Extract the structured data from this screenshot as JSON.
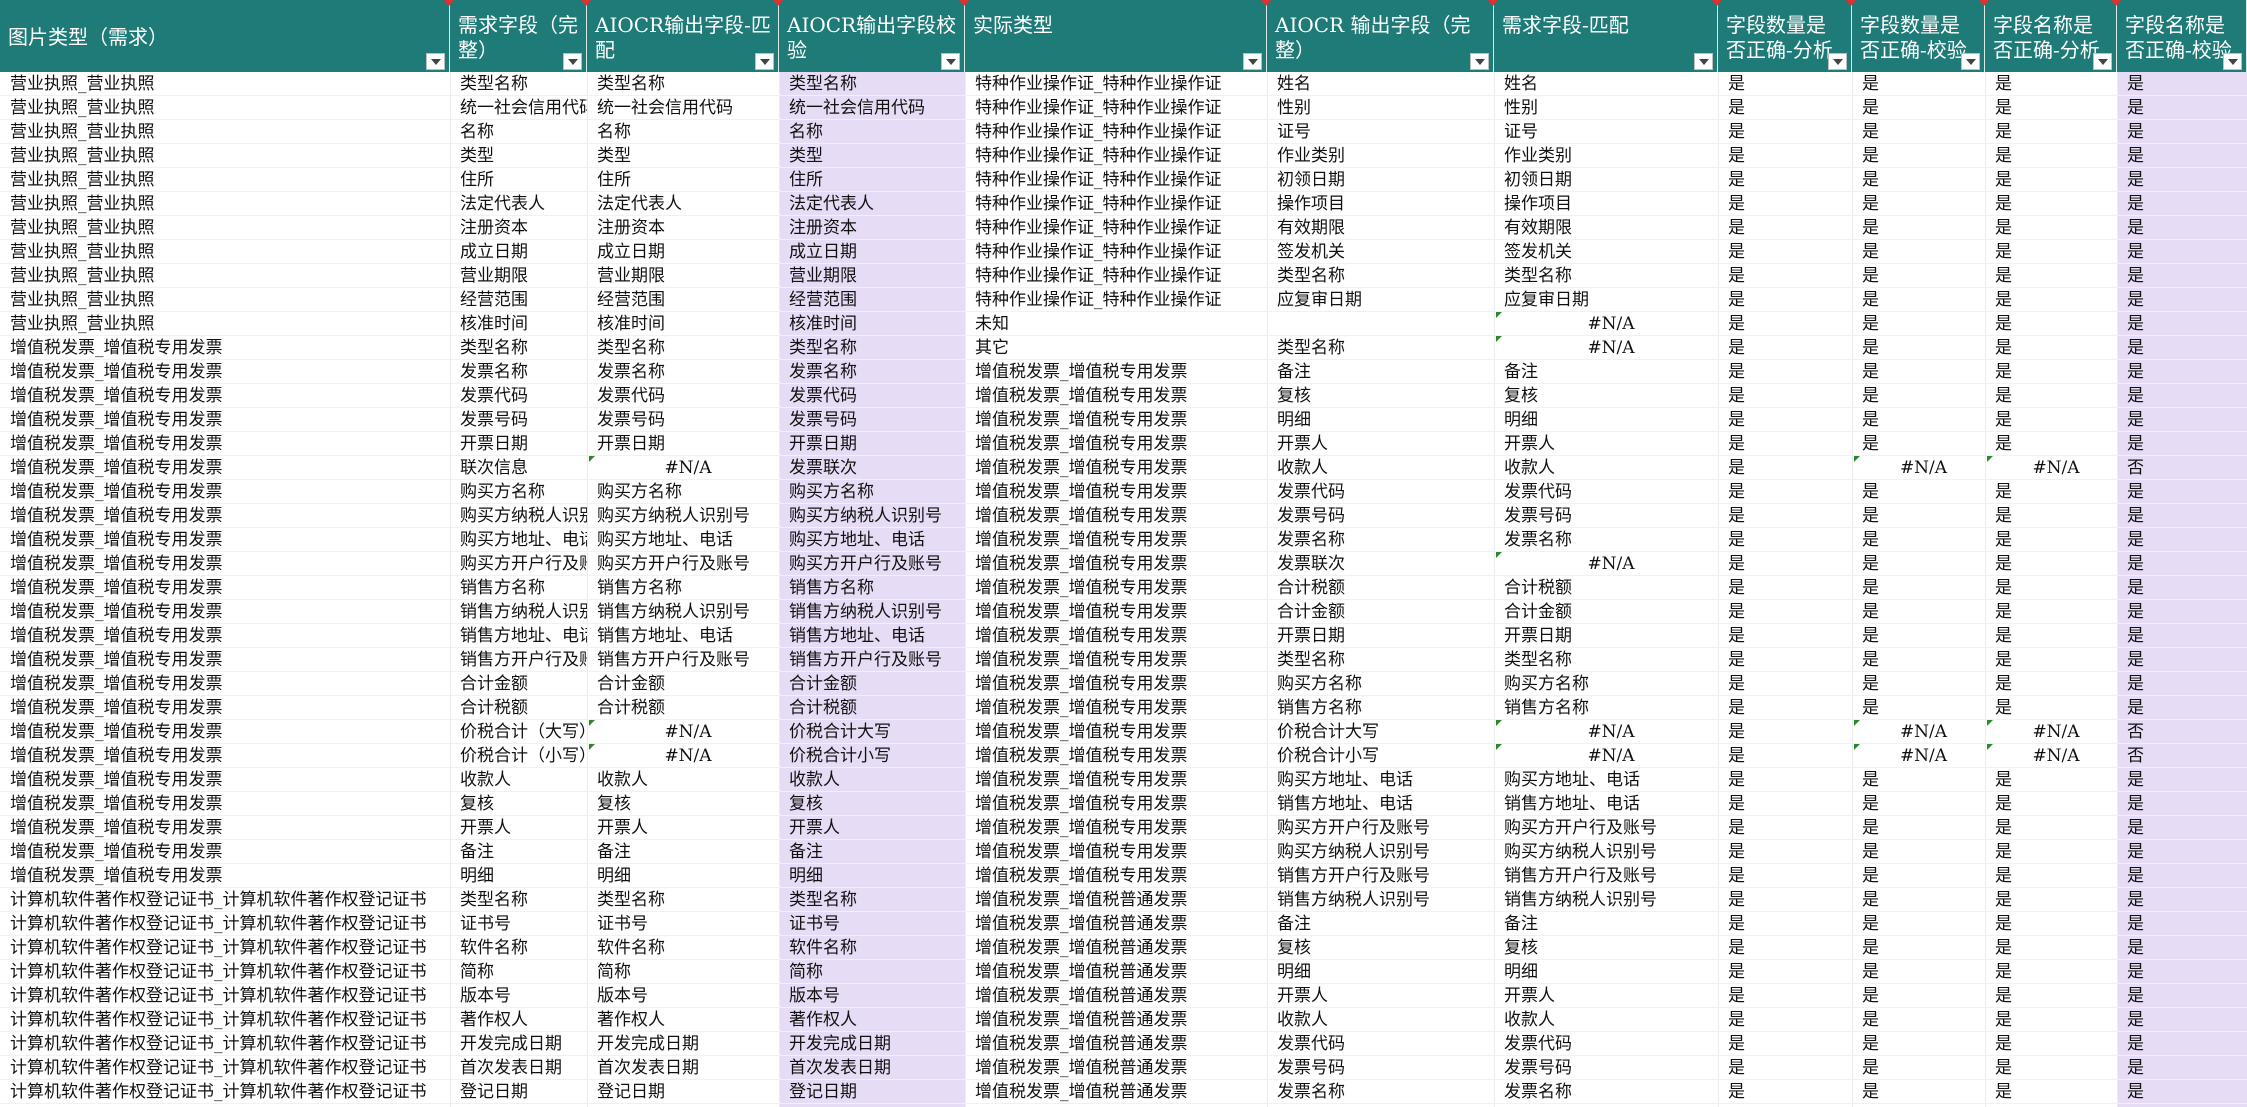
{
  "headers": [
    "图片类型（需求）",
    "需求字段（完整）",
    "AIOCR输出字段-匹配",
    "AIOCR输出字段校验",
    "实际类型",
    "AIOCR 输出字段（完整）",
    "需求字段-匹配",
    "字段数量是否正确-分析",
    "字段数量是否正确-校验",
    "字段名称是否正确-分析",
    "字段名称是否正确-校验"
  ],
  "colors": {
    "header_bg": "#1f7b77",
    "validation_col_bg": "#e6dcf5",
    "error_triangle": "#2a8a2a"
  },
  "icons": [
    "filter-dropdown-icon",
    "comment-marker-icon",
    "error-indicator-icon"
  ],
  "rows": [
    [
      "营业执照_营业执照",
      "类型名称",
      "类型名称",
      "类型名称",
      "特种作业操作证_特种作业操作证",
      "姓名",
      "姓名",
      "是",
      "是",
      "是",
      "是"
    ],
    [
      "营业执照_营业执照",
      "统一社会信用代码",
      "统一社会信用代码",
      "统一社会信用代码",
      "特种作业操作证_特种作业操作证",
      "性别",
      "性别",
      "是",
      "是",
      "是",
      "是"
    ],
    [
      "营业执照_营业执照",
      "名称",
      "名称",
      "名称",
      "特种作业操作证_特种作业操作证",
      "证号",
      "证号",
      "是",
      "是",
      "是",
      "是"
    ],
    [
      "营业执照_营业执照",
      "类型",
      "类型",
      "类型",
      "特种作业操作证_特种作业操作证",
      "作业类别",
      "作业类别",
      "是",
      "是",
      "是",
      "是"
    ],
    [
      "营业执照_营业执照",
      "住所",
      "住所",
      "住所",
      "特种作业操作证_特种作业操作证",
      "初领日期",
      "初领日期",
      "是",
      "是",
      "是",
      "是"
    ],
    [
      "营业执照_营业执照",
      "法定代表人",
      "法定代表人",
      "法定代表人",
      "特种作业操作证_特种作业操作证",
      "操作项目",
      "操作项目",
      "是",
      "是",
      "是",
      "是"
    ],
    [
      "营业执照_营业执照",
      "注册资本",
      "注册资本",
      "注册资本",
      "特种作业操作证_特种作业操作证",
      "有效期限",
      "有效期限",
      "是",
      "是",
      "是",
      "是"
    ],
    [
      "营业执照_营业执照",
      "成立日期",
      "成立日期",
      "成立日期",
      "特种作业操作证_特种作业操作证",
      "签发机关",
      "签发机关",
      "是",
      "是",
      "是",
      "是"
    ],
    [
      "营业执照_营业执照",
      "营业期限",
      "营业期限",
      "营业期限",
      "特种作业操作证_特种作业操作证",
      "类型名称",
      "类型名称",
      "是",
      "是",
      "是",
      "是"
    ],
    [
      "营业执照_营业执照",
      "经营范围",
      "经营范围",
      "经营范围",
      "特种作业操作证_特种作业操作证",
      "应复审日期",
      "应复审日期",
      "是",
      "是",
      "是",
      "是"
    ],
    [
      "营业执照_营业执照",
      "核准时间",
      "核准时间",
      "核准时间",
      "未知",
      "",
      "#N/A",
      "是",
      "是",
      "是",
      "是"
    ],
    [
      "增值税发票_增值税专用发票",
      "类型名称",
      "类型名称",
      "类型名称",
      "其它",
      "类型名称",
      "#N/A",
      "是",
      "是",
      "是",
      "是"
    ],
    [
      "增值税发票_增值税专用发票",
      "发票名称",
      "发票名称",
      "发票名称",
      "增值税发票_增值税专用发票",
      "备注",
      "备注",
      "是",
      "是",
      "是",
      "是"
    ],
    [
      "增值税发票_增值税专用发票",
      "发票代码",
      "发票代码",
      "发票代码",
      "增值税发票_增值税专用发票",
      "复核",
      "复核",
      "是",
      "是",
      "是",
      "是"
    ],
    [
      "增值税发票_增值税专用发票",
      "发票号码",
      "发票号码",
      "发票号码",
      "增值税发票_增值税专用发票",
      "明细",
      "明细",
      "是",
      "是",
      "是",
      "是"
    ],
    [
      "增值税发票_增值税专用发票",
      "开票日期",
      "开票日期",
      "开票日期",
      "增值税发票_增值税专用发票",
      "开票人",
      "开票人",
      "是",
      "是",
      "是",
      "是"
    ],
    [
      "增值税发票_增值税专用发票",
      "联次信息",
      "#N/A",
      "发票联次",
      "增值税发票_增值税专用发票",
      "收款人",
      "收款人",
      "是",
      "#N/A",
      "#N/A",
      "否"
    ],
    [
      "增值税发票_增值税专用发票",
      "购买方名称",
      "购买方名称",
      "购买方名称",
      "增值税发票_增值税专用发票",
      "发票代码",
      "发票代码",
      "是",
      "是",
      "是",
      "是"
    ],
    [
      "增值税发票_增值税专用发票",
      "购买方纳税人识别号",
      "购买方纳税人识别号",
      "购买方纳税人识别号",
      "增值税发票_增值税专用发票",
      "发票号码",
      "发票号码",
      "是",
      "是",
      "是",
      "是"
    ],
    [
      "增值税发票_增值税专用发票",
      "购买方地址、电话",
      "购买方地址、电话",
      "购买方地址、电话",
      "增值税发票_增值税专用发票",
      "发票名称",
      "发票名称",
      "是",
      "是",
      "是",
      "是"
    ],
    [
      "增值税发票_增值税专用发票",
      "购买方开户行及账号",
      "购买方开户行及账号",
      "购买方开户行及账号",
      "增值税发票_增值税专用发票",
      "发票联次",
      "#N/A",
      "是",
      "是",
      "是",
      "是"
    ],
    [
      "增值税发票_增值税专用发票",
      "销售方名称",
      "销售方名称",
      "销售方名称",
      "增值税发票_增值税专用发票",
      "合计税额",
      "合计税额",
      "是",
      "是",
      "是",
      "是"
    ],
    [
      "增值税发票_增值税专用发票",
      "销售方纳税人识别号",
      "销售方纳税人识别号",
      "销售方纳税人识别号",
      "增值税发票_增值税专用发票",
      "合计金额",
      "合计金额",
      "是",
      "是",
      "是",
      "是"
    ],
    [
      "增值税发票_增值税专用发票",
      "销售方地址、电话",
      "销售方地址、电话",
      "销售方地址、电话",
      "增值税发票_增值税专用发票",
      "开票日期",
      "开票日期",
      "是",
      "是",
      "是",
      "是"
    ],
    [
      "增值税发票_增值税专用发票",
      "销售方开户行及账号",
      "销售方开户行及账号",
      "销售方开户行及账号",
      "增值税发票_增值税专用发票",
      "类型名称",
      "类型名称",
      "是",
      "是",
      "是",
      "是"
    ],
    [
      "增值税发票_增值税专用发票",
      "合计金额",
      "合计金额",
      "合计金额",
      "增值税发票_增值税专用发票",
      "购买方名称",
      "购买方名称",
      "是",
      "是",
      "是",
      "是"
    ],
    [
      "增值税发票_增值税专用发票",
      "合计税额",
      "合计税额",
      "合计税额",
      "增值税发票_增值税专用发票",
      "销售方名称",
      "销售方名称",
      "是",
      "是",
      "是",
      "是"
    ],
    [
      "增值税发票_增值税专用发票",
      "价税合计（大写）",
      "#N/A",
      "价税合计大写",
      "增值税发票_增值税专用发票",
      "价税合计大写",
      "#N/A",
      "是",
      "#N/A",
      "#N/A",
      "否"
    ],
    [
      "增值税发票_增值税专用发票",
      "价税合计（小写）",
      "#N/A",
      "价税合计小写",
      "增值税发票_增值税专用发票",
      "价税合计小写",
      "#N/A",
      "是",
      "#N/A",
      "#N/A",
      "否"
    ],
    [
      "增值税发票_增值税专用发票",
      "收款人",
      "收款人",
      "收款人",
      "增值税发票_增值税专用发票",
      "购买方地址、电话",
      "购买方地址、电话",
      "是",
      "是",
      "是",
      "是"
    ],
    [
      "增值税发票_增值税专用发票",
      "复核",
      "复核",
      "复核",
      "增值税发票_增值税专用发票",
      "销售方地址、电话",
      "销售方地址、电话",
      "是",
      "是",
      "是",
      "是"
    ],
    [
      "增值税发票_增值税专用发票",
      "开票人",
      "开票人",
      "开票人",
      "增值税发票_增值税专用发票",
      "购买方开户行及账号",
      "购买方开户行及账号",
      "是",
      "是",
      "是",
      "是"
    ],
    [
      "增值税发票_增值税专用发票",
      "备注",
      "备注",
      "备注",
      "增值税发票_增值税专用发票",
      "购买方纳税人识别号",
      "购买方纳税人识别号",
      "是",
      "是",
      "是",
      "是"
    ],
    [
      "增值税发票_增值税专用发票",
      "明细",
      "明细",
      "明细",
      "增值税发票_增值税专用发票",
      "销售方开户行及账号",
      "销售方开户行及账号",
      "是",
      "是",
      "是",
      "是"
    ],
    [
      "计算机软件著作权登记证书_计算机软件著作权登记证书",
      "类型名称",
      "类型名称",
      "类型名称",
      "增值税发票_增值税普通发票",
      "销售方纳税人识别号",
      "销售方纳税人识别号",
      "是",
      "是",
      "是",
      "是"
    ],
    [
      "计算机软件著作权登记证书_计算机软件著作权登记证书",
      "证书号",
      "证书号",
      "证书号",
      "增值税发票_增值税普通发票",
      "备注",
      "备注",
      "是",
      "是",
      "是",
      "是"
    ],
    [
      "计算机软件著作权登记证书_计算机软件著作权登记证书",
      "软件名称",
      "软件名称",
      "软件名称",
      "增值税发票_增值税普通发票",
      "复核",
      "复核",
      "是",
      "是",
      "是",
      "是"
    ],
    [
      "计算机软件著作权登记证书_计算机软件著作权登记证书",
      "简称",
      "简称",
      "简称",
      "增值税发票_增值税普通发票",
      "明细",
      "明细",
      "是",
      "是",
      "是",
      "是"
    ],
    [
      "计算机软件著作权登记证书_计算机软件著作权登记证书",
      "版本号",
      "版本号",
      "版本号",
      "增值税发票_增值税普通发票",
      "开票人",
      "开票人",
      "是",
      "是",
      "是",
      "是"
    ],
    [
      "计算机软件著作权登记证书_计算机软件著作权登记证书",
      "著作权人",
      "著作权人",
      "著作权人",
      "增值税发票_增值税普通发票",
      "收款人",
      "收款人",
      "是",
      "是",
      "是",
      "是"
    ],
    [
      "计算机软件著作权登记证书_计算机软件著作权登记证书",
      "开发完成日期",
      "开发完成日期",
      "开发完成日期",
      "增值税发票_增值税普通发票",
      "发票代码",
      "发票代码",
      "是",
      "是",
      "是",
      "是"
    ],
    [
      "计算机软件著作权登记证书_计算机软件著作权登记证书",
      "首次发表日期",
      "首次发表日期",
      "首次发表日期",
      "增值税发票_增值税普通发票",
      "发票号码",
      "发票号码",
      "是",
      "是",
      "是",
      "是"
    ],
    [
      "计算机软件著作权登记证书_计算机软件著作权登记证书",
      "登记日期",
      "登记日期",
      "登记日期",
      "增值税发票_增值税普通发票",
      "发票名称",
      "发票名称",
      "是",
      "是",
      "是",
      "是"
    ]
  ]
}
